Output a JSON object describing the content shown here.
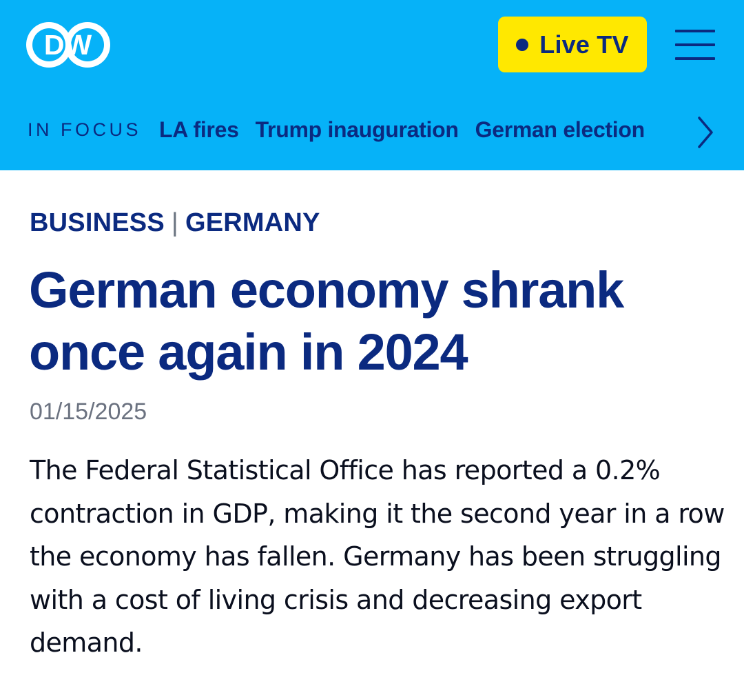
{
  "header": {
    "logo_text": "DW",
    "live_button_label": "Live TV",
    "menu_icon": "hamburger-menu-icon",
    "background_color": "#06b2f8",
    "accent_color": "#0b2a80",
    "live_button_color": "#ffe800"
  },
  "focus_bar": {
    "label": "IN FOCUS",
    "links": [
      {
        "label": "LA fires"
      },
      {
        "label": "Trump inauguration"
      },
      {
        "label": "German election"
      }
    ],
    "next_icon": "chevron-right-icon"
  },
  "article": {
    "category_1": "BUSINESS",
    "separator": "|",
    "category_2": "GERMANY",
    "headline": "German economy shrank once again in 2024",
    "date": "01/15/2025",
    "teaser": "The Federal Statistical Office has reported a 0.2% contraction in GDP, making it the second year in a row the economy has fallen. Germany has been struggling with a cost of living crisis and decreasing export demand."
  }
}
